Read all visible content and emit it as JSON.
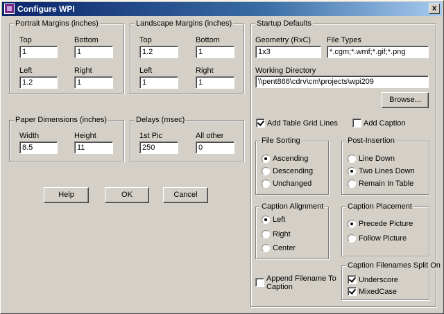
{
  "window": {
    "title": "Configure WPI",
    "close_glyph": "x"
  },
  "portrait": {
    "title": "Portrait Margins (inches)",
    "top_label": "Top",
    "top_value": "1",
    "bottom_label": "Bottom",
    "bottom_value": "1",
    "left_label": "Left",
    "left_value": "1.2",
    "right_label": "Right",
    "right_value": "1"
  },
  "landscape": {
    "title": "Landscape Margins (inches)",
    "top_label": "Top",
    "top_value": "1.2",
    "bottom_label": "Bottom",
    "bottom_value": "1",
    "left_label": "Left",
    "left_value": "1",
    "right_label": "Right",
    "right_value": "1"
  },
  "paper": {
    "title": "Paper Dimensions (inches)",
    "width_label": "Width",
    "width_value": "8.5",
    "height_label": "Height",
    "height_value": "11"
  },
  "delays": {
    "title": "Delays (msec)",
    "first_label": "1st Pic",
    "first_value": "250",
    "other_label": "All other",
    "other_value": "0"
  },
  "buttons": {
    "help": "Help",
    "ok": "OK",
    "cancel": "Cancel",
    "browse": "Browse..."
  },
  "startup": {
    "title": "Startup Defaults",
    "geometry_label": "Geometry (RxC)",
    "geometry_value": "1x3",
    "filetypes_label": "File Types",
    "filetypes_value": "*.cgm;*.wmf;*.gif;*.png",
    "workdir_label": "Working Directory",
    "workdir_value": "\\\\pent866\\cdrv\\cm\\projects\\wpi209",
    "grid_lines_label": "Add Table Grid Lines",
    "grid_lines_checked": true,
    "add_caption_label": "Add Caption",
    "add_caption_checked": false
  },
  "file_sorting": {
    "title": "File Sorting",
    "options": [
      "Ascending",
      "Descending",
      "Unchanged"
    ],
    "selected": "Ascending"
  },
  "post_insertion": {
    "title": "Post-Insertion",
    "options": [
      "Line Down",
      "Two Lines Down",
      "Remain In Table"
    ],
    "selected": "Two Lines Down"
  },
  "caption_alignment": {
    "title": "Caption Alignment",
    "options": [
      "Left",
      "Right",
      "Center"
    ],
    "selected": "Left"
  },
  "caption_placement": {
    "title": "Caption Placement",
    "options": [
      "Precede Picture",
      "Follow Picture"
    ],
    "selected": "Precede Picture"
  },
  "append_filename": {
    "line1": "Append Filename To",
    "line2": "Caption",
    "checked": false
  },
  "filename_split": {
    "title": "Caption Filenames Split On",
    "underscore_label": "Underscore",
    "underscore_checked": true,
    "mixedcase_label": "MixedCase",
    "mixedcase_checked": true
  }
}
